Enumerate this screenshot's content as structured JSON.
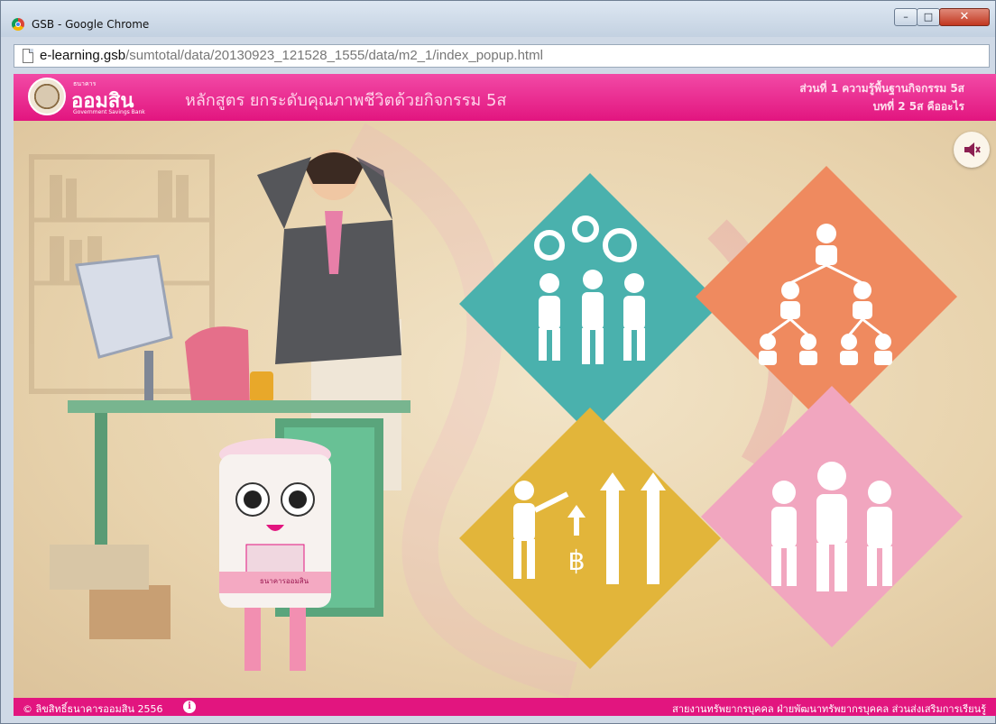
{
  "window": {
    "title": "GSB - Google Chrome",
    "min_glyph": "–",
    "max_glyph": "□",
    "close_glyph": "✕"
  },
  "address": {
    "host": "e-learning.gsb",
    "path": "/sumtotal/data/20130923_121528_1555/data/m2_1/index_popup.html"
  },
  "header": {
    "logo_small": "ธนาคาร",
    "logo_name": "ออมสิน",
    "logo_sub": "Government Savings Bank",
    "course_title": "หลักสูตร ยกระดับคุณภาพชีวิตด้วยกิจกรรม 5ส",
    "part_title": "ส่วนที่ 1 ความรู้พื้นฐานกิจกรรม 5ส",
    "chapter_title": "บทที่ 2 5ส คืออะไร"
  },
  "tiles": {
    "teal": "#4ab1ad",
    "orange": "#ef8a5f",
    "yellow": "#e2b53a",
    "pink": "#f1a6bf",
    "baht_symbol": "฿"
  },
  "mascot": {
    "label": "ธนาคารออมสิน"
  },
  "footer": {
    "copyright": "© ลิขสิทธิ์ธนาคารออมสิน 2556",
    "info_glyph": "i",
    "department": "สายงานทรัพยากรบุคคล ฝ่ายพัฒนาทรัพยากรบุคคล ส่วนส่งเสริมการเรียนรู้"
  }
}
